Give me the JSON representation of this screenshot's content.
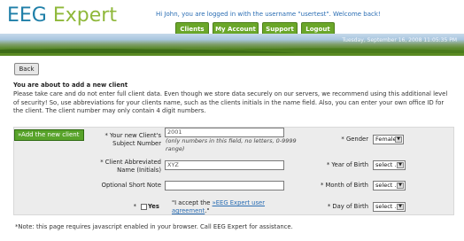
{
  "header": {
    "logo_part1": "EEG",
    "logo_part2": "Expert",
    "welcome": "Hi John, you are logged in with the username \"usertest\". Welcome back!"
  },
  "nav": {
    "tabs": [
      {
        "label": "Clients"
      },
      {
        "label": "My Account"
      },
      {
        "label": "Support"
      },
      {
        "label": "Logout"
      }
    ]
  },
  "banner": {
    "date": "Tuesday, September 16, 2008 11:05:35 PM"
  },
  "back_label": "Back",
  "intro": {
    "heading": "You are about to add a new client",
    "body": "Please take care and do not enter full client data. Even though we store data securely on our servers, we recommend using this additional level of security! So, use abbreviations for your clients name, such as the clients initials in the name field. Also, you can enter your own office ID for the client. The client number may only contain 4 digit numbers."
  },
  "form": {
    "add_button": "»Add the new client",
    "subject_number_label": "* Your new Client's Subject Number",
    "subject_number_value": "2001",
    "subject_number_hint": "(only numbers in this field, no letters, 0-9999 range)",
    "initials_label": "* Client Abbreviated Name (Initials)",
    "initials_value": "XYZ",
    "short_note_label": "Optional Short Note",
    "short_note_value": "",
    "agree_star": "*",
    "agree_yes": "Yes",
    "agree_text_prefix": "\"I accept the ",
    "agree_link": "»EEG Expert user agreement",
    "agree_text_suffix": ".\"",
    "gender_label": "* Gender",
    "gender_value": "Female",
    "birth_year_label": "* Year of Birth",
    "birth_year_value": "select ...",
    "birth_month_label": "* Month of Birth",
    "birth_month_value": "select ...",
    "birth_day_label": "* Day of Birth",
    "birth_day_value": "select ..."
  },
  "note": "*Note: this page requires javascript enabled in your browser. Call EEG Expert for assistance."
}
